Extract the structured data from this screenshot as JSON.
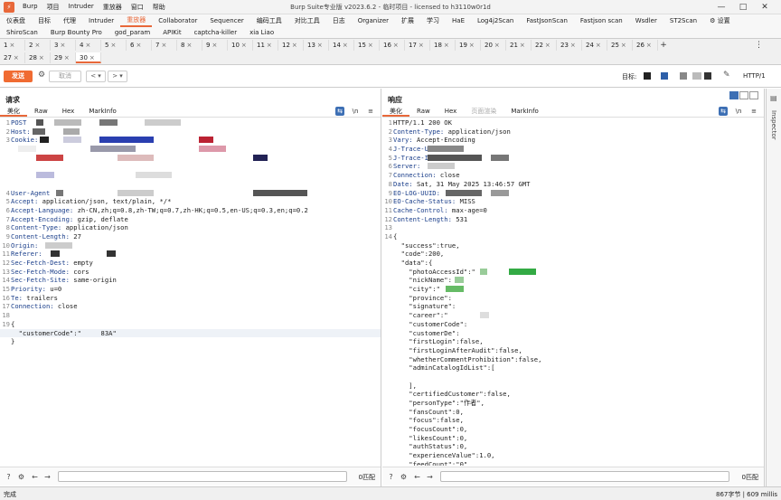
{
  "window": {
    "title": "Burp Suite专业版  v2023.6.2 - 临时项目 - licensed to h3110w0r1d",
    "menu": [
      "Burp",
      "项目",
      "Intruder",
      "重放器",
      "窗口",
      "帮助"
    ],
    "controls": [
      "—",
      "□",
      "✕"
    ]
  },
  "tool_tabs_row1": [
    "仪表盘",
    "目标",
    "代理",
    "Intruder",
    "重放器",
    "Collaborator",
    "Sequencer",
    "编码工具",
    "对比工具",
    "日志",
    "Organizer",
    "扩展",
    "学习",
    "HaE",
    "Log4j2Scan",
    "FastJsonScan",
    "Fastjson scan",
    "Wsdler",
    "ST2Scan",
    "⚙ 设置"
  ],
  "tool_tabs_row1_active": 4,
  "tool_tabs_row2": [
    "ShiroScan",
    "Burp Bounty Pro",
    "god_param",
    "APIKit",
    "captcha-killer",
    "xia Liao"
  ],
  "request_tabs_row1": [
    "1",
    "2",
    "3",
    "4",
    "5",
    "6",
    "7",
    "8",
    "9",
    "10",
    "11",
    "12",
    "13",
    "14",
    "15",
    "16",
    "17",
    "18",
    "19",
    "20",
    "21",
    "22",
    "23",
    "24",
    "25",
    "26"
  ],
  "request_tabs_row2": [
    "27",
    "28",
    "29",
    "30"
  ],
  "request_tab_active": "30",
  "request_tab_close": "×",
  "toolbar": {
    "send_label": "发送",
    "cancel_label": "取消",
    "back_label": "<",
    "forward_label": ">",
    "target_label": "目标:",
    "http_version": "HTTP/1"
  },
  "request": {
    "title": "请求",
    "subtabs": [
      "美化",
      "Raw",
      "Hex",
      "MarkInfo"
    ],
    "lines": [
      {
        "n": "1",
        "k": "POST",
        "v": ""
      },
      {
        "n": "2",
        "k": "Host:",
        "v": ""
      },
      {
        "n": "3",
        "k": "Cookie:",
        "v": ""
      },
      {
        "n": "",
        "k": "",
        "v": ""
      },
      {
        "n": "",
        "k": "",
        "v": ""
      },
      {
        "n": "",
        "k": "",
        "v": ""
      },
      {
        "n": "",
        "k": "",
        "v": ""
      },
      {
        "n": "",
        "k": "",
        "v": ""
      },
      {
        "n": "4",
        "k": "User-Agent",
        "v": ""
      },
      {
        "n": "5",
        "k": "Accept:",
        "v": " application/json, text/plain, */*"
      },
      {
        "n": "6",
        "k": "Accept-Language:",
        "v": " zh-CN,zh;q=0.8,zh-TW;q=0.7,zh-HK;q=0.5,en-US;q=0.3,en;q=0.2"
      },
      {
        "n": "7",
        "k": "Accept-Encoding:",
        "v": " gzip, deflate"
      },
      {
        "n": "8",
        "k": "Content-Type:",
        "v": " application/json"
      },
      {
        "n": "9",
        "k": "Content-Length:",
        "v": " 27"
      },
      {
        "n": "10",
        "k": "Origin:",
        "v": ""
      },
      {
        "n": "11",
        "k": "Referer:",
        "v": ""
      },
      {
        "n": "12",
        "k": "Sec-Fetch-Dest:",
        "v": " empty"
      },
      {
        "n": "13",
        "k": "Sec-Fetch-Mode:",
        "v": " cors"
      },
      {
        "n": "14",
        "k": "Sec-Fetch-Site:",
        "v": " same-origin"
      },
      {
        "n": "15",
        "k": "Priority:",
        "v": " u=0"
      },
      {
        "n": "16",
        "k": "Te:",
        "v": " trailers"
      },
      {
        "n": "17",
        "k": "Connection:",
        "v": " close"
      },
      {
        "n": "18",
        "k": "",
        "v": ""
      },
      {
        "n": "19",
        "k": "",
        "v": "{"
      },
      {
        "n": "",
        "k": "",
        "v": "  \"customerCode\":\"     83A\""
      },
      {
        "n": "",
        "k": "",
        "v": "}"
      }
    ],
    "footer_count": "0匹配"
  },
  "response": {
    "title": "响应",
    "subtabs": [
      "美化",
      "Raw",
      "Hex",
      "页面渲染",
      "MarkInfo"
    ],
    "lines": [
      {
        "n": "1",
        "k": "",
        "v": "HTTP/1.1 200 OK"
      },
      {
        "n": "2",
        "k": "Content-Type:",
        "v": " application/json"
      },
      {
        "n": "3",
        "k": "Vary:",
        "v": " Accept-Encoding"
      },
      {
        "n": "4",
        "k": "J-Trace-UA",
        "v": ""
      },
      {
        "n": "5",
        "k": "J-Trace-ID",
        "v": ""
      },
      {
        "n": "6",
        "k": "Server:",
        "v": ""
      },
      {
        "n": "7",
        "k": "Connection:",
        "v": " close"
      },
      {
        "n": "8",
        "k": "Date:",
        "v": " Sat, 31 May 2025 13:46:57 GMT"
      },
      {
        "n": "9",
        "k": "EO-LOG-UUID:",
        "v": ""
      },
      {
        "n": "10",
        "k": "EO-Cache-Status:",
        "v": " MISS"
      },
      {
        "n": "11",
        "k": "Cache-Control:",
        "v": " max-age=0"
      },
      {
        "n": "12",
        "k": "Content-Length:",
        "v": " 531"
      },
      {
        "n": "13",
        "k": "",
        "v": ""
      },
      {
        "n": "14",
        "k": "",
        "v": "{"
      },
      {
        "n": "",
        "k": "",
        "v": "  \"success\":true,"
      },
      {
        "n": "",
        "k": "",
        "v": "  \"code\":200,"
      },
      {
        "n": "",
        "k": "",
        "v": "  \"data\":{"
      },
      {
        "n": "",
        "k": "",
        "v": "    \"photoAccessId\":\""
      },
      {
        "n": "",
        "k": "",
        "v": "    \"nickName\":"
      },
      {
        "n": "",
        "k": "",
        "v": "    \"city\":\""
      },
      {
        "n": "",
        "k": "",
        "v": "    \"province\":"
      },
      {
        "n": "",
        "k": "",
        "v": "    \"signature\":"
      },
      {
        "n": "",
        "k": "",
        "v": "    \"career\":\""
      },
      {
        "n": "",
        "k": "",
        "v": "    \"customerCode\":"
      },
      {
        "n": "",
        "k": "",
        "v": "    \"customerDe\":"
      },
      {
        "n": "",
        "k": "",
        "v": "    \"firstLogin\":false,"
      },
      {
        "n": "",
        "k": "",
        "v": "    \"firstLoginAfterAudit\":false,"
      },
      {
        "n": "",
        "k": "",
        "v": "    \"whetherCommentProhibition\":false,"
      },
      {
        "n": "",
        "k": "",
        "v": "    \"adminCatalogIdList\":["
      },
      {
        "n": "",
        "k": "",
        "v": ""
      },
      {
        "n": "",
        "k": "",
        "v": "    ],"
      },
      {
        "n": "",
        "k": "",
        "v": "    \"certifiedCustomer\":false,"
      },
      {
        "n": "",
        "k": "",
        "v": "    \"personType\":\"作者\","
      },
      {
        "n": "",
        "k": "",
        "v": "    \"fansCount\":0,"
      },
      {
        "n": "",
        "k": "",
        "v": "    \"focus\":false,"
      },
      {
        "n": "",
        "k": "",
        "v": "    \"focusCount\":0,"
      },
      {
        "n": "",
        "k": "",
        "v": "    \"likesCount\":0,"
      },
      {
        "n": "",
        "k": "",
        "v": "    \"authStatus\":0,"
      },
      {
        "n": "",
        "k": "",
        "v": "    \"experienceValue\":1.0,"
      },
      {
        "n": "",
        "k": "",
        "v": "    \"feedCount\":\"0\","
      }
    ],
    "footer_count": "0匹配"
  },
  "inspector_label": "Inspector",
  "status": {
    "left": "完成",
    "right": "867字节 | 609 millis"
  },
  "colors": {
    "accent": "#e8683a",
    "send_button": "#f06b32",
    "header_key": "#1a3e8a",
    "toggle_active": "#3d6fb4"
  }
}
